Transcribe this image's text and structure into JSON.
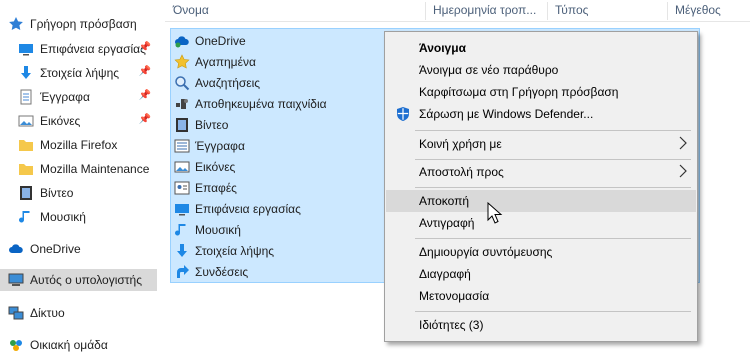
{
  "columns": {
    "name": "Όνομα",
    "date": "Ημερομηνία τροπ...",
    "type": "Τύπος",
    "size": "Μέγεθος"
  },
  "nav": {
    "quick_access": "Γρήγορη πρόσβαση",
    "quick_items": [
      {
        "label": "Επιφάνεια εργασίας",
        "icon": "desktop-icon",
        "pinned": true
      },
      {
        "label": "Στοιχεία λήψης",
        "icon": "download-icon",
        "pinned": true
      },
      {
        "label": "Έγγραφα",
        "icon": "documents-icon",
        "pinned": true
      },
      {
        "label": "Εικόνες",
        "icon": "pictures-icon",
        "pinned": true
      },
      {
        "label": "Mozilla Firefox",
        "icon": "folder-icon",
        "pinned": false
      },
      {
        "label": "Mozilla Maintenance",
        "icon": "folder-icon",
        "pinned": false
      },
      {
        "label": "Βίντεο",
        "icon": "videos-icon",
        "pinned": false
      },
      {
        "label": "Μουσική",
        "icon": "music-icon",
        "pinned": false
      }
    ],
    "onedrive": "OneDrive",
    "this_pc": "Αυτός ο υπολογιστής",
    "network": "Δίκτυο",
    "homegroup": "Οικιακή ομάδα",
    "pin_glyph": "📌"
  },
  "files": [
    {
      "label": "OneDrive",
      "icon": "onedrive-icon"
    },
    {
      "label": "Αγαπημένα",
      "icon": "star-icon"
    },
    {
      "label": "Αναζητήσεις",
      "icon": "search-icon"
    },
    {
      "label": "Αποθηκευμένα παιχνίδια",
      "icon": "games-icon"
    },
    {
      "label": "Βίντεο",
      "icon": "videos-icon"
    },
    {
      "label": "Έγγραφα",
      "icon": "documents-icon"
    },
    {
      "label": "Εικόνες",
      "icon": "pictures-icon"
    },
    {
      "label": "Επαφές",
      "icon": "contacts-icon"
    },
    {
      "label": "Επιφάνεια εργασίας",
      "icon": "desktop-icon"
    },
    {
      "label": "Μουσική",
      "icon": "music-icon"
    },
    {
      "label": "Στοιχεία λήψης",
      "icon": "download-icon"
    },
    {
      "label": "Συνδέσεις",
      "icon": "links-icon"
    }
  ],
  "context_menu": {
    "open": "Άνοιγμα",
    "open_new_window": "Άνοιγμα σε νέο παράθυρο",
    "pin_quick_access": "Καρφίτσωμα στη Γρήγορη πρόσβαση",
    "scan_defender": "Σάρωση με Windows Defender...",
    "share_with": "Κοινή χρήση με",
    "send_to": "Αποστολή προς",
    "cut": "Αποκοπή",
    "copy": "Αντιγραφή",
    "create_shortcut": "Δημιουργία συντόμευσης",
    "delete": "Διαγραφή",
    "rename": "Μετονομασία",
    "properties": "Ιδιότητες (3)"
  },
  "colors": {
    "selection_bg": "#cce8ff",
    "selection_border": "#99d1ff",
    "menu_bg": "#f0f0f0",
    "menu_hover": "#d9d9d9",
    "nav_selected": "#d9d9d9",
    "header_text": "#4c607a"
  }
}
